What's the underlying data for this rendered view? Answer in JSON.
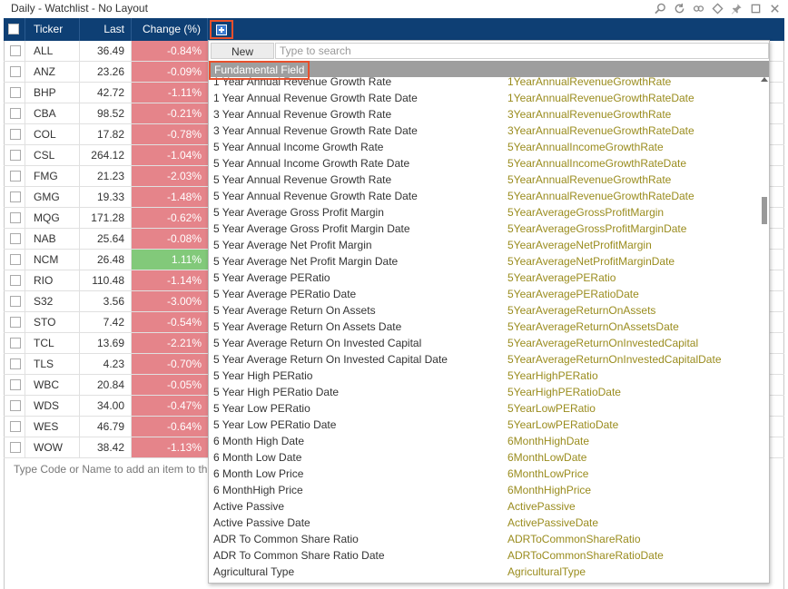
{
  "window": {
    "title": "Daily - Watchlist - No Layout"
  },
  "columns": {
    "ticker": "Ticker",
    "last": "Last",
    "change": "Change (%)"
  },
  "rows": [
    {
      "ticker": "ALL",
      "last": "36.49",
      "change": "-0.84%",
      "dir": "neg"
    },
    {
      "ticker": "ANZ",
      "last": "23.26",
      "change": "-0.09%",
      "dir": "neg"
    },
    {
      "ticker": "BHP",
      "last": "42.72",
      "change": "-1.11%",
      "dir": "neg"
    },
    {
      "ticker": "CBA",
      "last": "98.52",
      "change": "-0.21%",
      "dir": "neg"
    },
    {
      "ticker": "COL",
      "last": "17.82",
      "change": "-0.78%",
      "dir": "neg"
    },
    {
      "ticker": "CSL",
      "last": "264.12",
      "change": "-1.04%",
      "dir": "neg"
    },
    {
      "ticker": "FMG",
      "last": "21.23",
      "change": "-2.03%",
      "dir": "neg"
    },
    {
      "ticker": "GMG",
      "last": "19.33",
      "change": "-1.48%",
      "dir": "neg"
    },
    {
      "ticker": "MQG",
      "last": "171.28",
      "change": "-0.62%",
      "dir": "neg"
    },
    {
      "ticker": "NAB",
      "last": "25.64",
      "change": "-0.08%",
      "dir": "neg"
    },
    {
      "ticker": "NCM",
      "last": "26.48",
      "change": "1.11%",
      "dir": "pos"
    },
    {
      "ticker": "RIO",
      "last": "110.48",
      "change": "-1.14%",
      "dir": "neg"
    },
    {
      "ticker": "S32",
      "last": "3.56",
      "change": "-3.00%",
      "dir": "neg"
    },
    {
      "ticker": "STO",
      "last": "7.42",
      "change": "-0.54%",
      "dir": "neg"
    },
    {
      "ticker": "TCL",
      "last": "13.69",
      "change": "-2.21%",
      "dir": "neg"
    },
    {
      "ticker": "TLS",
      "last": "4.23",
      "change": "-0.70%",
      "dir": "neg"
    },
    {
      "ticker": "WBC",
      "last": "20.84",
      "change": "-0.05%",
      "dir": "neg"
    },
    {
      "ticker": "WDS",
      "last": "34.00",
      "change": "-0.47%",
      "dir": "neg"
    },
    {
      "ticker": "WES",
      "last": "46.79",
      "change": "-0.64%",
      "dir": "neg"
    },
    {
      "ticker": "WOW",
      "last": "38.42",
      "change": "-1.13%",
      "dir": "neg"
    }
  ],
  "add_hint": "Type Code or Name to add an item to the watchlist",
  "picker": {
    "new_label": "New",
    "search_placeholder": "Type to search",
    "group_label": "Fundamental Field",
    "items": [
      {
        "name": "1 Year Annual Revenue Growth Rate",
        "field": "1YearAnnualRevenueGrowthRate"
      },
      {
        "name": "1 Year Annual Revenue Growth Rate Date",
        "field": "1YearAnnualRevenueGrowthRateDate"
      },
      {
        "name": "3 Year Annual Revenue Growth Rate",
        "field": "3YearAnnualRevenueGrowthRate"
      },
      {
        "name": "3 Year Annual Revenue Growth Rate Date",
        "field": "3YearAnnualRevenueGrowthRateDate"
      },
      {
        "name": "5 Year Annual Income Growth Rate",
        "field": "5YearAnnualIncomeGrowthRate"
      },
      {
        "name": "5 Year Annual Income Growth Rate Date",
        "field": "5YearAnnualIncomeGrowthRateDate"
      },
      {
        "name": "5 Year Annual Revenue Growth Rate",
        "field": "5YearAnnualRevenueGrowthRate"
      },
      {
        "name": "5 Year Annual Revenue Growth Rate Date",
        "field": "5YearAnnualRevenueGrowthRateDate"
      },
      {
        "name": "5 Year Average Gross Profit Margin",
        "field": "5YearAverageGrossProfitMargin"
      },
      {
        "name": "5 Year Average Gross Profit Margin Date",
        "field": "5YearAverageGrossProfitMarginDate"
      },
      {
        "name": "5 Year Average Net Profit Margin",
        "field": "5YearAverageNetProfitMargin"
      },
      {
        "name": "5 Year Average Net Profit Margin Date",
        "field": "5YearAverageNetProfitMarginDate"
      },
      {
        "name": "5 Year Average PERatio",
        "field": "5YearAveragePERatio"
      },
      {
        "name": "5 Year Average PERatio Date",
        "field": "5YearAveragePERatioDate"
      },
      {
        "name": "5 Year Average Return On Assets",
        "field": "5YearAverageReturnOnAssets"
      },
      {
        "name": "5 Year Average Return On Assets Date",
        "field": "5YearAverageReturnOnAssetsDate"
      },
      {
        "name": "5 Year Average Return On Invested Capital",
        "field": "5YearAverageReturnOnInvestedCapital"
      },
      {
        "name": "5 Year Average Return On Invested Capital Date",
        "field": "5YearAverageReturnOnInvestedCapitalDate"
      },
      {
        "name": "5 Year High PERatio",
        "field": "5YearHighPERatio"
      },
      {
        "name": "5 Year High PERatio Date",
        "field": "5YearHighPERatioDate"
      },
      {
        "name": "5 Year Low PERatio",
        "field": "5YearLowPERatio"
      },
      {
        "name": "5 Year Low PERatio Date",
        "field": "5YearLowPERatioDate"
      },
      {
        "name": "6 Month High Date",
        "field": "6MonthHighDate"
      },
      {
        "name": "6 Month Low Date",
        "field": "6MonthLowDate"
      },
      {
        "name": "6 Month Low Price",
        "field": "6MonthLowPrice"
      },
      {
        "name": "6 MonthHigh Price",
        "field": "6MonthHighPrice"
      },
      {
        "name": "Active Passive",
        "field": "ActivePassive"
      },
      {
        "name": "Active Passive Date",
        "field": "ActivePassiveDate"
      },
      {
        "name": "ADR To Common Share Ratio",
        "field": "ADRToCommonShareRatio"
      },
      {
        "name": "ADR To Common Share Ratio Date",
        "field": "ADRToCommonShareRatioDate"
      },
      {
        "name": "Agricultural Type",
        "field": "AgriculturalType"
      }
    ]
  },
  "colors": {
    "header": "#0e3f74",
    "negative": "#e5848a",
    "positive": "#82c97a",
    "field_text": "#9a8c1e",
    "highlight": "#e8502c"
  }
}
